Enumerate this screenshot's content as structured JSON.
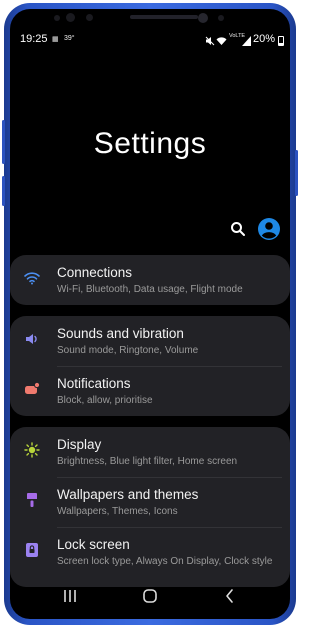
{
  "status_bar": {
    "time": "19:25",
    "temperature": "39°",
    "network": "VoLTE",
    "battery": "20%"
  },
  "page_title": "Settings",
  "items": [
    {
      "title": "Connections",
      "subtitle": "Wi-Fi, Bluetooth, Data usage, Flight mode",
      "icon": "wifi-icon",
      "color": "#4b8ef0"
    },
    {
      "title": "Sounds and vibration",
      "subtitle": "Sound mode, Ringtone, Volume",
      "icon": "speaker-icon",
      "color": "#8a8af0"
    },
    {
      "title": "Notifications",
      "subtitle": "Block, allow, prioritise",
      "icon": "notification-icon",
      "color": "#f07a6e"
    },
    {
      "title": "Display",
      "subtitle": "Brightness, Blue light filter, Home screen",
      "icon": "sun-icon",
      "color": "#b8d53a"
    },
    {
      "title": "Wallpapers and themes",
      "subtitle": "Wallpapers, Themes, Icons",
      "icon": "paintbrush-icon",
      "color": "#a66be8"
    },
    {
      "title": "Lock screen",
      "subtitle": "Screen lock type, Always On Display, Clock style",
      "icon": "lock-icon",
      "color": "#9b82f0"
    }
  ],
  "accent_color": "#1e88e5"
}
